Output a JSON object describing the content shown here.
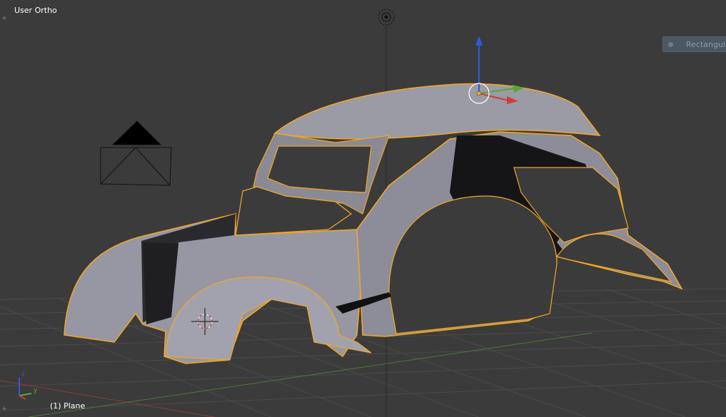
{
  "viewport": {
    "view_name": "User Ortho",
    "active_object": "(1) Plane",
    "tool_panel_label": "Rectangular"
  },
  "colors": {
    "background": "#3b3b3b",
    "grid": "#4a4a4a",
    "selection_outline": "#f5a623",
    "body_fill": "#8c8c96",
    "x_axis": "#d23b3b",
    "y_axis": "#58a82f",
    "z_axis": "#2f5bd8"
  },
  "icons": {
    "camera": "camera-icon",
    "origin_point": "origin-icon",
    "cursor_3d": "3d-cursor-icon",
    "transform_gizmo": "transform-gizmo-icon",
    "axis_widget": "axis-orientation-icon",
    "lamp": "lamp-icon"
  },
  "axis_widget": {
    "z_label": "z",
    "y_label": "y"
  }
}
